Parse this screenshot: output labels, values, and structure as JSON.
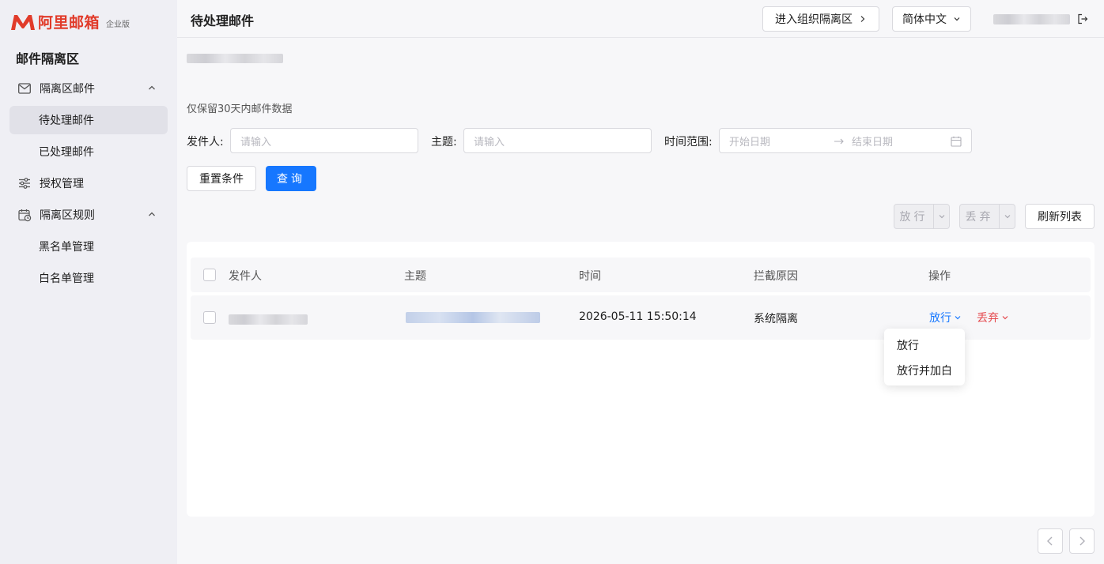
{
  "brand": {
    "name": "阿里邮箱",
    "edition": "企业版",
    "color": "#e13b2a"
  },
  "sidebar": {
    "section_title": "邮件隔离区",
    "items": [
      {
        "label": "隔离区邮件",
        "icon": "mail-icon",
        "expanded": true
      },
      {
        "label": "待处理邮件",
        "active": true
      },
      {
        "label": "已处理邮件"
      },
      {
        "label": "授权管理",
        "icon": "sliders-icon"
      },
      {
        "label": "隔离区规则",
        "icon": "calendar-clock-icon",
        "expanded": true
      },
      {
        "label": "黑名单管理"
      },
      {
        "label": "白名单管理"
      }
    ]
  },
  "header": {
    "title": "待处理邮件",
    "enter_org_button": "进入组织隔离区",
    "language": "简体中文"
  },
  "main": {
    "notice": "仅保留30天内邮件数据",
    "filters": {
      "sender_label": "发件人:",
      "sender_placeholder": "请输入",
      "subject_label": "主题:",
      "subject_placeholder": "请输入",
      "time_label": "时间范围:",
      "start_placeholder": "开始日期",
      "end_placeholder": "结束日期"
    },
    "buttons": {
      "reset": "重置条件",
      "query": "查询",
      "release": "放行",
      "discard": "丢弃",
      "refresh": "刷新列表"
    },
    "table": {
      "columns": [
        "发件人",
        "主题",
        "时间",
        "拦截原因",
        "操作"
      ],
      "rows": [
        {
          "time": "2026-05-11 15:50:14",
          "reason": "系统隔离",
          "action_release": "放行",
          "action_discard": "丢弃"
        }
      ]
    },
    "release_menu": [
      "放行",
      "放行并加白"
    ]
  },
  "colors": {
    "primary": "#1677ff",
    "danger": "#e5484d",
    "sidebar_bg": "#efeff4"
  }
}
